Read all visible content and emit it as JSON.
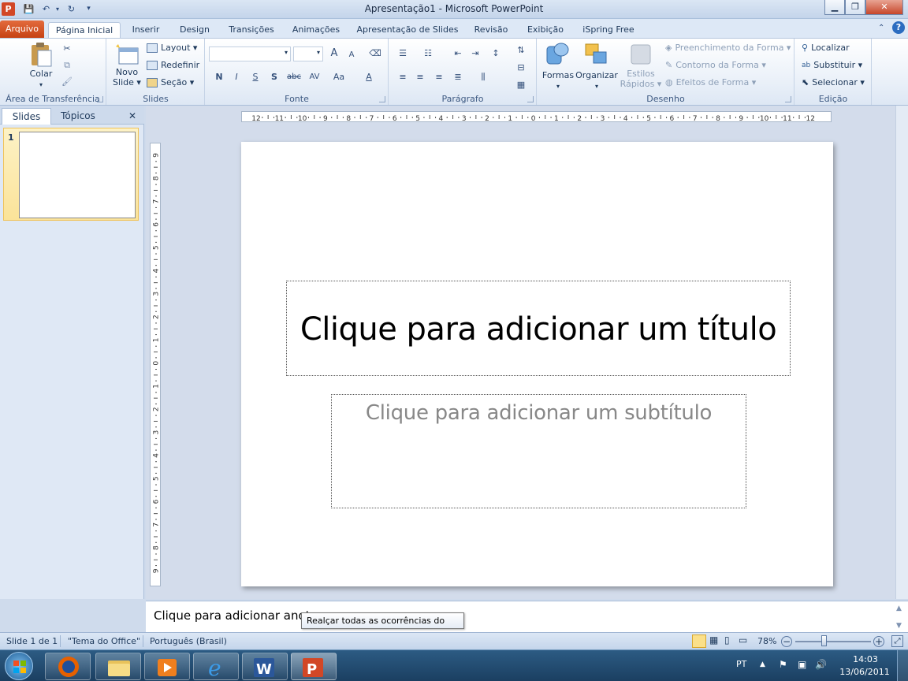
{
  "window": {
    "title": "Apresentação1  -  Microsoft PowerPoint",
    "minimize": "▁",
    "maximize": "❐",
    "close": "✕"
  },
  "quick_access": {
    "save": "💾",
    "undo": "↶",
    "redo": "↻",
    "customize": "▾"
  },
  "tabs": {
    "file": "Arquivo",
    "home": "Página Inicial",
    "insert": "Inserir",
    "design": "Design",
    "transitions": "Transições",
    "animations": "Animações",
    "slideshow": "Apresentação de Slides",
    "review": "Revisão",
    "view": "Exibição",
    "ispring": "iSpring Free"
  },
  "ribbon": {
    "clipboard": {
      "label": "Área de Transferência",
      "paste": "Colar"
    },
    "slides": {
      "label": "Slides",
      "new_slide_1": "Novo",
      "new_slide_2": "Slide",
      "layout": "Layout",
      "reset": "Redefinir",
      "section": "Seção"
    },
    "font": {
      "label": "Fonte",
      "bold": "N",
      "italic": "I",
      "underline": "S",
      "shadow": "S",
      "strike": "abc",
      "spacing": "AV",
      "case": "Aa",
      "grow": "A",
      "shrink": "A",
      "color": "A"
    },
    "paragraph": {
      "label": "Parágrafo"
    },
    "drawing": {
      "label": "Desenho",
      "shapes": "Formas",
      "arrange": "Organizar",
      "quick_styles_1": "Estilos",
      "quick_styles_2": "Rápidos",
      "shape_fill": "Preenchimento da Forma",
      "shape_outline": "Contorno da Forma",
      "shape_effects": "Efeitos de Forma"
    },
    "editing": {
      "label": "Edição",
      "find": "Localizar",
      "replace": "Substituir",
      "select": "Selecionar"
    }
  },
  "left_panel": {
    "tab_slides": "Slides",
    "tab_outline": "Tópicos",
    "close": "✕",
    "slide_number": "1"
  },
  "rulers": {
    "horizontal": [
      "12",
      "11",
      "10",
      "9",
      "8",
      "7",
      "6",
      "5",
      "4",
      "3",
      "2",
      "1",
      "0",
      "1",
      "2",
      "3",
      "4",
      "5",
      "6",
      "7",
      "8",
      "9",
      "10",
      "11",
      "12"
    ],
    "vertical": [
      "9",
      "8",
      "7",
      "6",
      "5",
      "4",
      "3",
      "2",
      "1",
      "0",
      "1",
      "2",
      "3",
      "4",
      "5",
      "6",
      "7",
      "8",
      "9"
    ]
  },
  "slide": {
    "title_placeholder": "Clique para adicionar um título",
    "subtitle_placeholder": "Clique para adicionar um subtítulo"
  },
  "notes": {
    "placeholder": "Clique para adicionar anota"
  },
  "tooltip": {
    "text": "Realçar todas as ocorrências do texto"
  },
  "status": {
    "slide_info": "Slide 1 de 1",
    "theme": "\"Tema do Office\"",
    "language": "Português (Brasil)",
    "zoom": "78%",
    "zoom_level_percent": 78
  },
  "taskbar": {
    "language": "PT",
    "time": "14:03",
    "date": "13/06/2011"
  }
}
